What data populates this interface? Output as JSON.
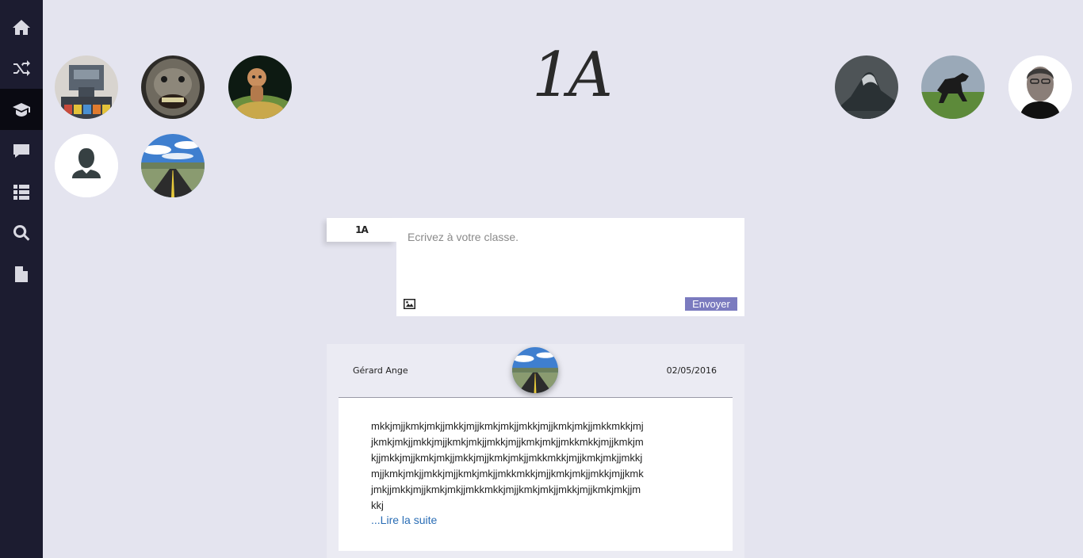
{
  "sidebar": {
    "items": [
      {
        "icon": "home-icon",
        "active": false
      },
      {
        "icon": "shuffle-icon",
        "active": false
      },
      {
        "icon": "graduation-cap-icon",
        "active": true
      },
      {
        "icon": "chat-icon",
        "active": false
      },
      {
        "icon": "list-icon",
        "active": false
      },
      {
        "icon": "search-icon",
        "active": false
      },
      {
        "icon": "document-icon",
        "active": false
      }
    ]
  },
  "header": {
    "class_name": "1A"
  },
  "members": {
    "left": [
      "robot-avatar",
      "gorilla-avatar",
      "sackboy-avatar",
      "default-user-avatar",
      "road-avatar"
    ],
    "right": [
      "wave-avatar",
      "horse-avatar",
      "steve-jobs-avatar"
    ]
  },
  "composer": {
    "tag": "1A",
    "placeholder": "Ecrivez à votre classe.",
    "send_label": "Envoyer"
  },
  "post": {
    "author": "Gérard Ange",
    "date": "02/05/2016",
    "body": "mkkjmjjkmkjmkjjmkkjmjjkmkjmkjjmkkjmjjkmkjmkjjmkkmkkjmjjkmkjmkjjmkkjmjjkmkjmkjjmkkjmjjkmkjmkjjmkkmkkjmjjkmkjmkjjmkkjmjjkmkjmkjjmkkjmjjkmkjmkjjmkkmkkjmjjkmkjmkjjmkkjmjjkmkjmkjjmkkjmjjkmkjmkjjmkkmkkjmjjkmkjmkjjmkkjmjjkmkjmkjjmkkjmjjkmkjmkjjmkkmkkjmjjkmkjmkjjmkkjmjjkmkjmkjjmkkj",
    "read_more": "...Lire la suite"
  },
  "colors": {
    "sidebar_bg": "#1c1c30",
    "page_bg": "#e4e4ef",
    "accent": "#7b7bbf",
    "link": "#2a6db5"
  }
}
